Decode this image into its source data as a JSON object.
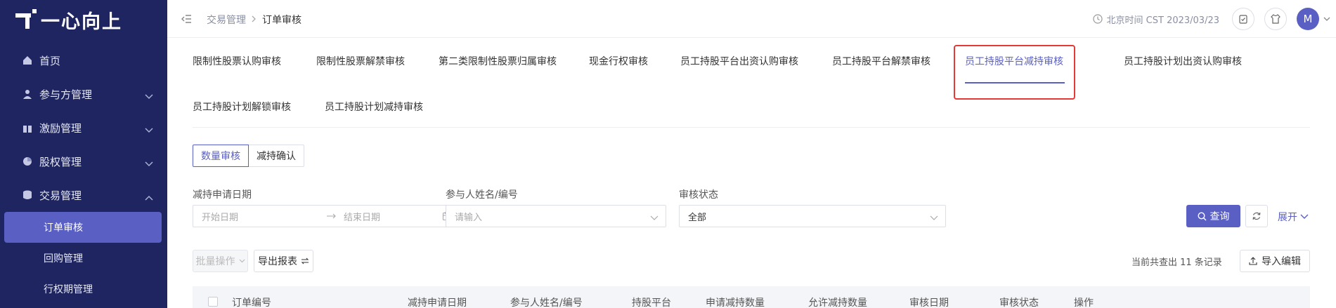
{
  "app": {
    "logo_text": "一心向上"
  },
  "sidebar": {
    "items": [
      {
        "label": "首页",
        "icon": "home-icon"
      },
      {
        "label": "参与方管理",
        "icon": "users-icon"
      },
      {
        "label": "激励管理",
        "icon": "gift-icon"
      },
      {
        "label": "股权管理",
        "icon": "pie-icon"
      },
      {
        "label": "交易管理",
        "icon": "database-icon"
      }
    ],
    "sub_items": [
      {
        "label": "订单审核"
      },
      {
        "label": "回购管理"
      },
      {
        "label": "行权期管理"
      }
    ]
  },
  "header": {
    "breadcrumb": [
      "交易管理",
      "订单审核"
    ],
    "time": "北京时间 CST 2023/03/23",
    "avatar": "M"
  },
  "tabs": [
    "限制性股票认购审核",
    "限制性股票解禁审核",
    "第二类限制性股票归属审核",
    "现金行权审核",
    "员工持股平台出资认购审核",
    "员工持股平台解禁审核",
    "员工持股平台减持审核",
    "员工持股计划出资认购审核",
    "员工持股计划解锁审核",
    "员工持股计划减持审核"
  ],
  "segment": [
    "数量审核",
    "减持确认"
  ],
  "filters": {
    "date_label": "减持申请日期",
    "date_start_placeholder": "开始日期",
    "date_end_placeholder": "结束日期",
    "participant_label": "参与人姓名/编号",
    "participant_placeholder": "请输入",
    "status_label": "审核状态",
    "status_value": "全部"
  },
  "actions": {
    "query": "查询",
    "expand": "展开",
    "batch": "批量操作",
    "export": "导出报表",
    "import": "导入编辑",
    "record_count": "当前共查出 11 条记录"
  },
  "table": {
    "columns": [
      "订单编号",
      "减持申请日期",
      "参与人姓名/编号",
      "持股平台",
      "申请减持数量",
      "允许减持数量",
      "审核日期",
      "审核状态",
      "操作"
    ]
  },
  "colors": {
    "sidebar": "#1e2560",
    "accent": "#5a5fc4",
    "highlight": "#e53935"
  }
}
